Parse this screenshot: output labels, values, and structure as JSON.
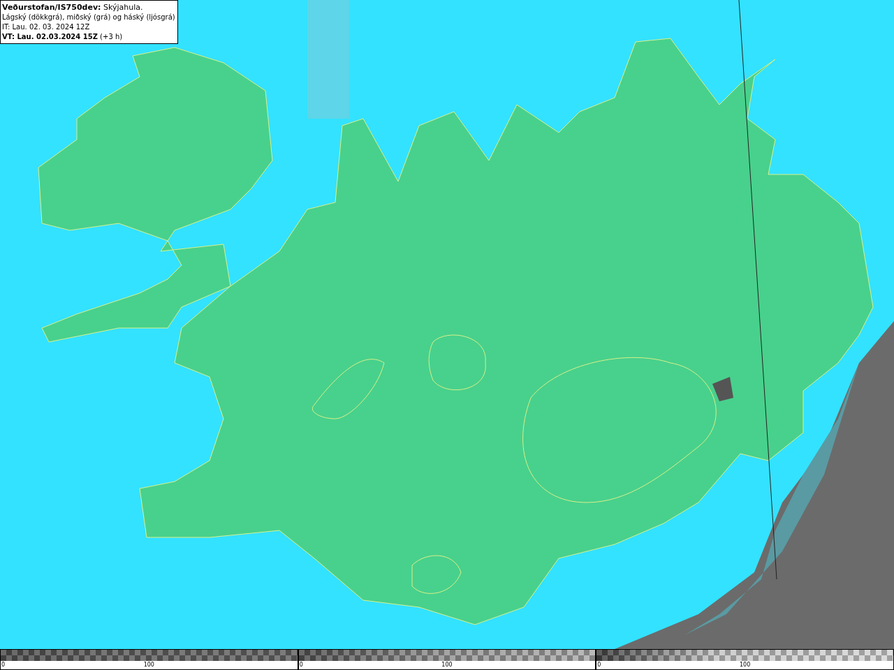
{
  "legend": {
    "lines": [
      "**Veðurstofan/IS750dev:** Skýjahula.",
      "Lágský (dökkgrá), miðský (grá) og háský (ljósgrá)",
      "IT: Lau. 02. 03. 2024 12Z",
      "**VT: Lau. 02.03.2024 15Z** (+3 h)"
    ]
  },
  "colorbars": [
    {
      "kind": "low",
      "labels": [
        "0",
        "100"
      ]
    },
    {
      "kind": "mid",
      "labels": [
        "0",
        "100"
      ]
    },
    {
      "kind": "high",
      "labels": [
        "0",
        "100"
      ]
    }
  ]
}
